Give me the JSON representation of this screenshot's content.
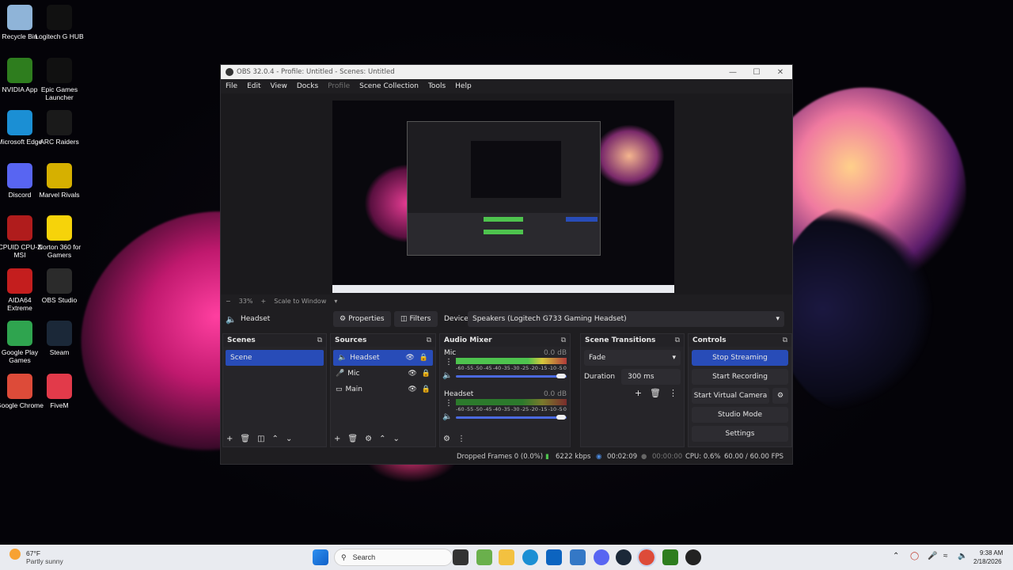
{
  "desktop": {
    "icons": [
      {
        "label": "Recycle Bin",
        "icon": "recycle-bin-icon",
        "color": "#8fb4d8"
      },
      {
        "label": "Logitech G HUB",
        "icon": "logitech-g-icon",
        "color": "#111111"
      },
      {
        "label": "NVIDIA App",
        "icon": "nvidia-icon",
        "color": "#2e7d1e"
      },
      {
        "label": "Epic Games Launcher",
        "icon": "epic-games-icon",
        "color": "#111111"
      },
      {
        "label": "Microsoft Edge",
        "icon": "edge-icon",
        "color": "#1b8fd4"
      },
      {
        "label": "ARC Raiders",
        "icon": "arc-raiders-icon",
        "color": "#1a1a1a"
      },
      {
        "label": "Discord",
        "icon": "discord-icon",
        "color": "#5865f2"
      },
      {
        "label": "Marvel Rivals",
        "icon": "marvel-rivals-icon",
        "color": "#d6b000"
      },
      {
        "label": "CPUID CPU-Z MSI",
        "icon": "cpuz-icon",
        "color": "#b01c1c"
      },
      {
        "label": "Norton 360 for Gamers",
        "icon": "norton-icon",
        "color": "#f6d30a"
      },
      {
        "label": "AIDA64 Extreme",
        "icon": "aida64-icon",
        "color": "#c41e1e"
      },
      {
        "label": "OBS Studio",
        "icon": "obs-icon",
        "color": "#2b2b2b"
      },
      {
        "label": "Google Play Games",
        "icon": "google-play-games-icon",
        "color": "#2fa44f"
      },
      {
        "label": "Steam",
        "icon": "steam-icon",
        "color": "#1b2838"
      },
      {
        "label": "Google Chrome",
        "icon": "chrome-icon",
        "color": "#dd4b39"
      },
      {
        "label": "FiveM",
        "icon": "fivem-icon",
        "color": "#e23a4a"
      }
    ]
  },
  "window": {
    "title": "OBS 32.0.4 - Profile: Untitled - Scenes: Untitled"
  },
  "menu": [
    "File",
    "Edit",
    "View",
    "Docks",
    "Profile",
    "Scene Collection",
    "Tools",
    "Help"
  ],
  "zoom": {
    "minus": "−",
    "level": "33%",
    "plus": "+",
    "scale_mode": "Scale to Window"
  },
  "propbar": {
    "source_name": "Headset",
    "properties": "Properties",
    "filters": "Filters",
    "device_label": "Device",
    "device_value": "Speakers (Logitech G733 Gaming Headset)"
  },
  "scenes": {
    "title": "Scenes",
    "items": [
      "Scene"
    ]
  },
  "sources": {
    "title": "Sources",
    "items": [
      {
        "name": "Headset",
        "icon": "speaker-icon"
      },
      {
        "name": "Mic",
        "icon": "mic-icon"
      },
      {
        "name": "Main",
        "icon": "monitor-icon"
      }
    ]
  },
  "mixer": {
    "title": "Audio Mixer",
    "channels": [
      {
        "name": "Mic",
        "db": "0.0 dB",
        "volume": 0.95
      },
      {
        "name": "Headset",
        "db": "0.0 dB",
        "volume": 0.95
      }
    ],
    "scale": [
      "-60",
      "-55",
      "-50",
      "-45",
      "-40",
      "-35",
      "-30",
      "-25",
      "-20",
      "-15",
      "-10",
      "-5",
      "0"
    ]
  },
  "transitions": {
    "title": "Scene Transitions",
    "selected": "Fade",
    "duration_label": "Duration",
    "duration_value": "300 ms"
  },
  "controls": {
    "title": "Controls",
    "buttons": [
      "Stop Streaming",
      "Start Recording",
      "Start Virtual Camera",
      "Studio Mode",
      "Settings"
    ]
  },
  "status": {
    "dropped": "Dropped Frames 0 (0.0%)",
    "bitrate": "6222 kbps",
    "stream_time": "00:02:09",
    "rec_time": "00:00:00",
    "cpu": "CPU: 0.6%",
    "fps": "60.00 / 60.00 FPS"
  },
  "taskbar": {
    "weather_temp": "67°F",
    "weather_desc": "Partly sunny",
    "search": "Search",
    "time": "9:38 AM",
    "date": "2/18/2026"
  }
}
